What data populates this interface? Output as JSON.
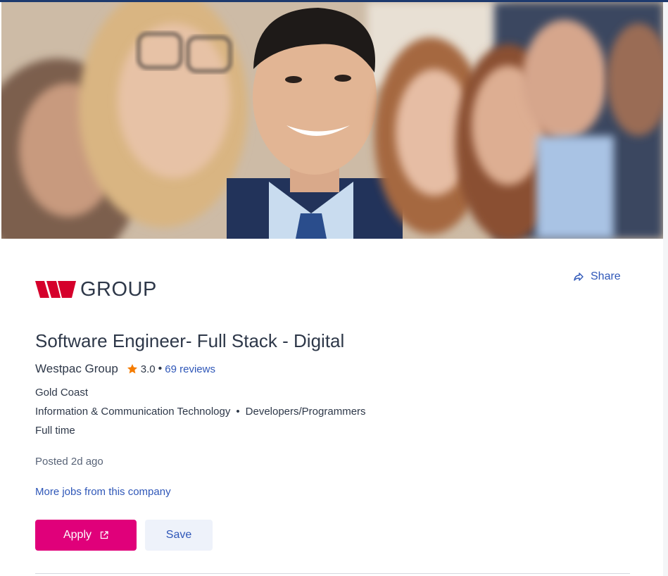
{
  "header": {
    "hero_image": "team-photo-smiling-people",
    "logo_text": "GROUP",
    "share_label": "Share"
  },
  "job": {
    "title": "Software Engineer- Full Stack - Digital",
    "company": "Westpac Group",
    "rating": "3.0",
    "rating_separator": "•",
    "reviews_label": "69 reviews",
    "location": "Gold Coast",
    "category": "Information & Communication Technology",
    "category_separator": "•",
    "subcategory": "Developers/Programmers",
    "work_type": "Full time",
    "posted": "Posted 2d ago",
    "more_jobs_label": "More jobs from this company"
  },
  "actions": {
    "apply_label": "Apply",
    "save_label": "Save"
  },
  "colors": {
    "brand_red": "#d5002b",
    "apply_pink": "#e0007a",
    "link_blue": "#2f57b8",
    "star_orange": "#f57c00",
    "text_dark": "#2e3849"
  },
  "icons": {
    "share": "share-arrow-icon",
    "star": "star-icon",
    "external": "external-link-icon"
  }
}
